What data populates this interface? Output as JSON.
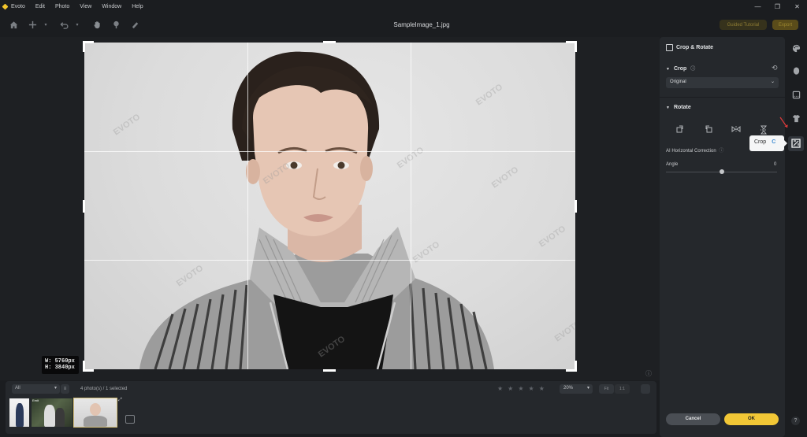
{
  "app": {
    "name": "Evoto"
  },
  "menu": [
    "Evoto",
    "Edit",
    "Photo",
    "View",
    "Window",
    "Help"
  ],
  "window_controls": [
    "—",
    "❐",
    "✕"
  ],
  "toolbar": {
    "tools": [
      "home-icon",
      "add-icon",
      "undo-icon",
      "hand-icon",
      "brush-icon",
      "eraser-icon"
    ],
    "filename": "SampleImage_1.jpg",
    "tutorial_label": "Guided Tutorial",
    "export_label": "Export"
  },
  "canvas": {
    "dims_w": "W: 5760px",
    "dims_h": "H: 3840px",
    "watermark": "EVOTO"
  },
  "filmstrip": {
    "filter_value": "All",
    "count_text": "4 photo(s) / 1 selected",
    "stars": [
      "★",
      "★",
      "★",
      "★",
      "★"
    ],
    "zoom_value": "20%",
    "fit_label": "Fit",
    "one_label": "1:1",
    "thumb_tag": "Emit"
  },
  "panel": {
    "title": "Crop & Rotate",
    "crop_header": "Crop",
    "ratio_value": "Original",
    "rotate_header": "Rotate",
    "ai_label": "AI Horizontal Correction",
    "angle_label": "Angle",
    "angle_value": "0",
    "cancel_label": "Cancel",
    "ok_label": "OK"
  },
  "tooltip": {
    "label": "Crop",
    "key": "C"
  },
  "colors": {
    "accent": "#f2c736",
    "panel_bg": "#25282c",
    "app_bg": "#1b1d20"
  }
}
